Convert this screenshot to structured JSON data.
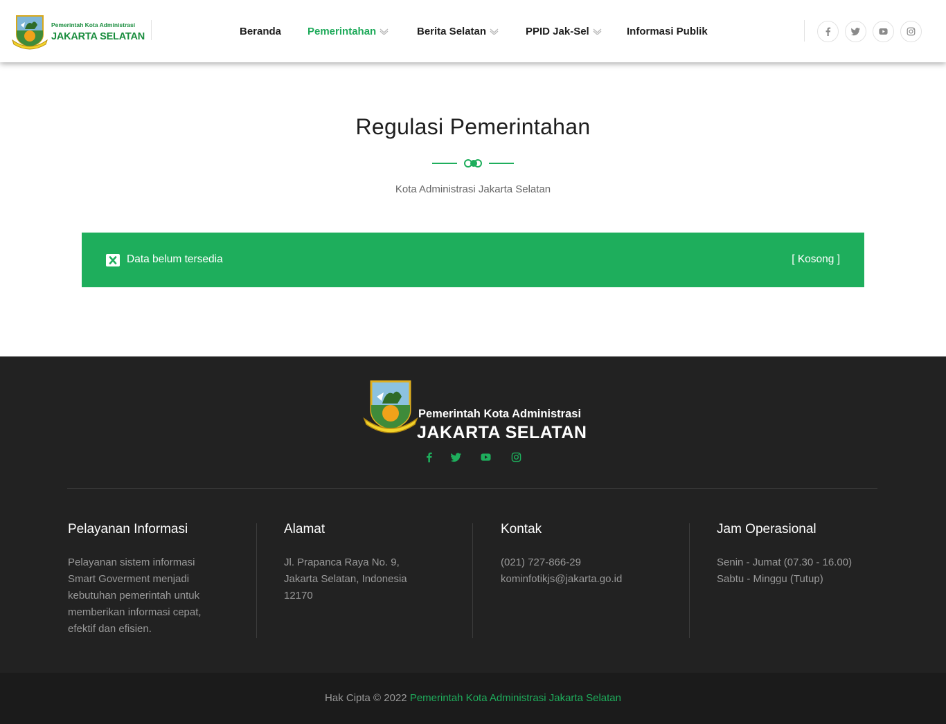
{
  "header": {
    "logo": {
      "line1": "Pemerintah Kota Administrasi",
      "line2": "JAKARTA SELATAN"
    },
    "nav": [
      {
        "label": "Beranda",
        "active": false,
        "dropdown": false
      },
      {
        "label": "Pemerintahan",
        "active": true,
        "dropdown": true
      },
      {
        "label": "Berita Selatan",
        "active": false,
        "dropdown": true
      },
      {
        "label": "PPID Jak-Sel",
        "active": false,
        "dropdown": true
      },
      {
        "label": "Informasi Publik",
        "active": false,
        "dropdown": false
      }
    ],
    "social_icons": [
      "facebook-icon",
      "twitter-icon",
      "youtube-icon",
      "instagram-icon"
    ]
  },
  "main": {
    "title": "Regulasi Pemerintahan",
    "subtitle": "Kota Administrasi Jakarta Selatan",
    "alert": {
      "icon": "close-square-icon",
      "message": "Data belum tersedia",
      "status": "[ Kosong ]"
    }
  },
  "footer": {
    "logo": {
      "line1": "Pemerintah Kota Administrasi",
      "line2": "JAKARTA SELATAN"
    },
    "social_icons": [
      "facebook-icon",
      "twitter-icon",
      "youtube-icon",
      "instagram-icon"
    ],
    "columns": [
      {
        "title": "Pelayanan Informasi",
        "lines": [
          "Pelayanan sistem informasi",
          "Smart Goverment menjadi",
          "kebutuhan pemerintah untuk",
          "memberikan informasi cepat,",
          "efektif dan efisien."
        ]
      },
      {
        "title": "Alamat",
        "lines": [
          "Jl. Prapanca Raya No. 9,",
          "Jakarta Selatan, Indonesia",
          "12170"
        ]
      },
      {
        "title": "Kontak",
        "lines": [
          "(021) 727-866-29",
          "kominfotikjs@jakarta.go.id"
        ]
      },
      {
        "title": "Jam Operasional",
        "lines": [
          "Senin - Jumat (07.30 - 16.00)",
          "Sabtu - Minggu (Tutup)"
        ]
      }
    ],
    "copyright": {
      "prefix": "Hak Cipta © 2022 ",
      "link": "Pemerintah Kota Administrasi Jakarta Selatan"
    }
  },
  "colors": {
    "accent": "#1eae5c",
    "footer_bg": "#222222",
    "copyright_bg": "#1b1b1b"
  }
}
